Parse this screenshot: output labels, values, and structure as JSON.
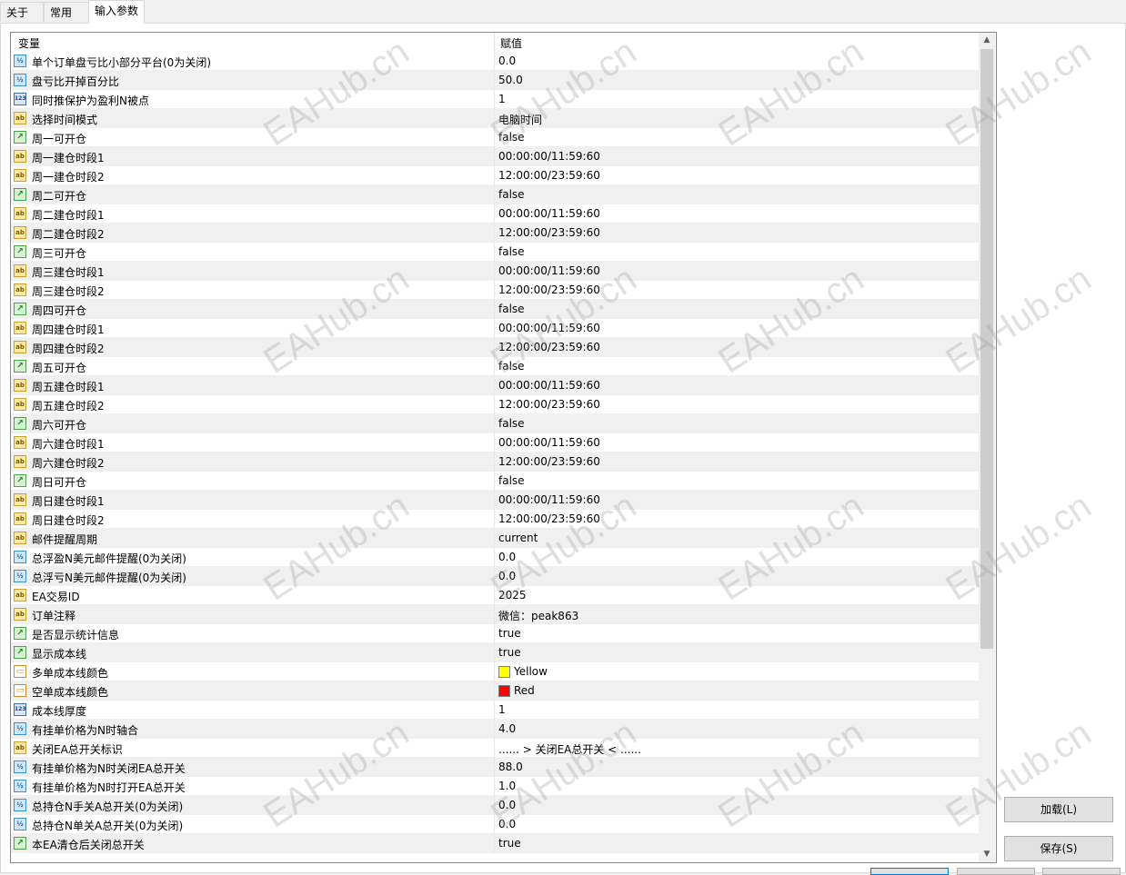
{
  "tabs": [
    {
      "label": "关于"
    },
    {
      "label": "常用"
    },
    {
      "label": "输入参数"
    }
  ],
  "grid": {
    "header_variable": "变量",
    "header_value": "赋值",
    "rows": [
      {
        "type": "half",
        "name": "单个订单盘亏比小部分平台(0为关闭)",
        "value": "0.0"
      },
      {
        "type": "half",
        "name": "盘亏比开掉百分比",
        "value": "50.0"
      },
      {
        "type": "123",
        "name": "同时推保护为盈利N被点",
        "value": "1"
      },
      {
        "type": "ab",
        "name": "选择时间模式",
        "value": "电脑时间"
      },
      {
        "type": "bool",
        "name": "周一可开仓",
        "value": "false"
      },
      {
        "type": "ab",
        "name": "周一建仓时段1",
        "value": "00:00:00/11:59:60"
      },
      {
        "type": "ab",
        "name": "周一建仓时段2",
        "value": "12:00:00/23:59:60"
      },
      {
        "type": "bool",
        "name": "周二可开仓",
        "value": "false"
      },
      {
        "type": "ab",
        "name": "周二建仓时段1",
        "value": "00:00:00/11:59:60"
      },
      {
        "type": "ab",
        "name": "周二建仓时段2",
        "value": "12:00:00/23:59:60"
      },
      {
        "type": "bool",
        "name": "周三可开仓",
        "value": "false"
      },
      {
        "type": "ab",
        "name": "周三建仓时段1",
        "value": "00:00:00/11:59:60"
      },
      {
        "type": "ab",
        "name": "周三建仓时段2",
        "value": "12:00:00/23:59:60"
      },
      {
        "type": "bool",
        "name": "周四可开仓",
        "value": "false"
      },
      {
        "type": "ab",
        "name": "周四建仓时段1",
        "value": "00:00:00/11:59:60"
      },
      {
        "type": "ab",
        "name": "周四建仓时段2",
        "value": "12:00:00/23:59:60"
      },
      {
        "type": "bool",
        "name": "周五可开仓",
        "value": "false"
      },
      {
        "type": "ab",
        "name": "周五建仓时段1",
        "value": "00:00:00/11:59:60"
      },
      {
        "type": "ab",
        "name": "周五建仓时段2",
        "value": "12:00:00/23:59:60"
      },
      {
        "type": "bool",
        "name": "周六可开仓",
        "value": "false"
      },
      {
        "type": "ab",
        "name": "周六建仓时段1",
        "value": "00:00:00/11:59:60"
      },
      {
        "type": "ab",
        "name": "周六建仓时段2",
        "value": "12:00:00/23:59:60"
      },
      {
        "type": "bool",
        "name": "周日可开仓",
        "value": "false"
      },
      {
        "type": "ab",
        "name": "周日建仓时段1",
        "value": "00:00:00/11:59:60"
      },
      {
        "type": "ab",
        "name": "周日建仓时段2",
        "value": "12:00:00/23:59:60"
      },
      {
        "type": "ab",
        "name": "邮件提醒周期",
        "value": "current"
      },
      {
        "type": "half",
        "name": "总浮盈N美元邮件提醒(0为关闭)",
        "value": "0.0"
      },
      {
        "type": "half",
        "name": "总浮亏N美元邮件提醒(0为关闭)",
        "value": "0.0"
      },
      {
        "type": "ab",
        "name": "EA交易ID",
        "value": "2025"
      },
      {
        "type": "ab",
        "name": "订单注释",
        "value": "微信：peak863"
      },
      {
        "type": "bool",
        "name": "是否显示统计信息",
        "value": "true"
      },
      {
        "type": "bool",
        "name": "显示成本线",
        "value": "true"
      },
      {
        "type": "color",
        "name": "多单成本线颜色",
        "value": "Yellow",
        "swatch": "#ffff00"
      },
      {
        "type": "color",
        "name": "空单成本线颜色",
        "value": "Red",
        "swatch": "#ff0000"
      },
      {
        "type": "123",
        "name": "成本线厚度",
        "value": "1"
      },
      {
        "type": "half",
        "name": "有挂单价格为N时轴合",
        "value": "4.0"
      },
      {
        "type": "ab",
        "name": "关闭EA总开关标识",
        "value": "...... > 关闭EA总开关 < ......"
      },
      {
        "type": "half",
        "name": "有挂单价格为N时关闭EA总开关",
        "value": "88.0"
      },
      {
        "type": "half",
        "name": "有挂单价格为N时打开EA总开关",
        "value": "1.0"
      },
      {
        "type": "half",
        "name": "总持仓N手关A总开关(0为关闭)",
        "value": "0.0"
      },
      {
        "type": "half",
        "name": "总持仓N单关A总开关(0为关闭)",
        "value": "0.0"
      },
      {
        "type": "bool",
        "name": "本EA清仓后关闭总开关",
        "value": "true"
      }
    ]
  },
  "icons": {
    "half": "½",
    "123": "123",
    "ab": "ab",
    "bool": "↗",
    "color": "▭"
  },
  "buttons": {
    "load": "加载(L)",
    "save": "保存(S)"
  },
  "watermark": "EAHub.cn"
}
